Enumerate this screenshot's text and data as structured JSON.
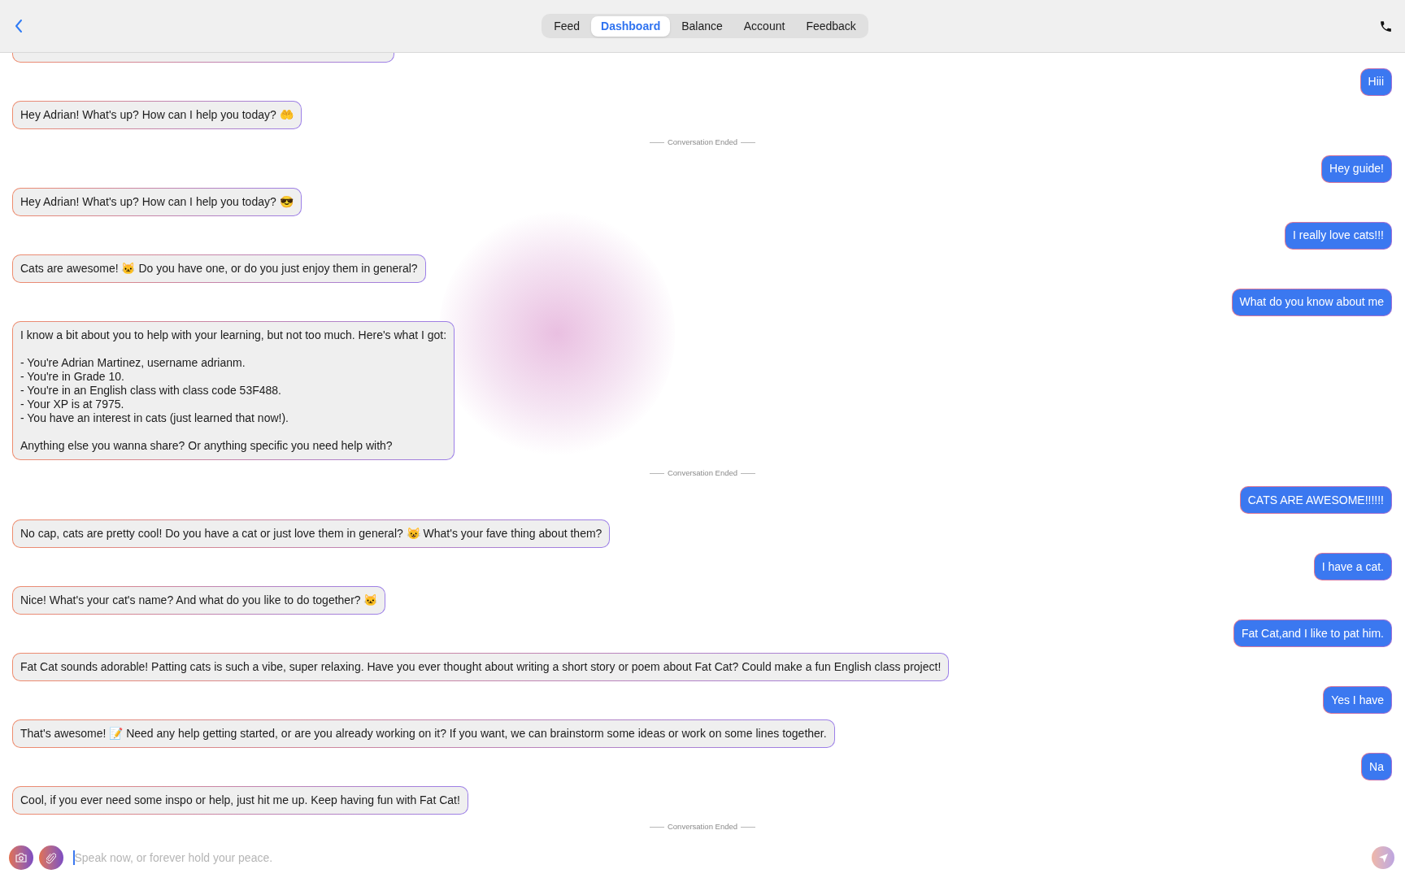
{
  "header": {
    "tabs": [
      {
        "label": "Feed",
        "selected": false
      },
      {
        "label": "Dashboard",
        "selected": true
      },
      {
        "label": "Balance",
        "selected": false
      },
      {
        "label": "Account",
        "selected": false
      },
      {
        "label": "Feedback",
        "selected": false
      }
    ]
  },
  "messages": [
    {
      "kind": "clipped"
    },
    {
      "kind": "outgoing",
      "text": "Hiii"
    },
    {
      "kind": "incoming",
      "text": "Hey Adrian! What's up? How can I help you today? 🤲"
    },
    {
      "kind": "divider",
      "text": "Conversation Ended"
    },
    {
      "kind": "outgoing",
      "text": "Hey guide!"
    },
    {
      "kind": "incoming",
      "text": "Hey Adrian! What's up? How can I help you today? 😎"
    },
    {
      "kind": "outgoing",
      "text": "I really love cats!!!"
    },
    {
      "kind": "incoming",
      "text": "Cats are awesome! 🐱 Do you have one, or do you just enjoy them in general?"
    },
    {
      "kind": "outgoing",
      "text": "What do you know about me"
    },
    {
      "kind": "incoming",
      "text": "I know a bit about you to help with your learning, but not too much. Here's what I got:\n\n- You're Adrian Martinez, username adrianm.\n- You're in Grade 10.\n- You're in an English class with class code 53F488.\n- Your XP is at 7975.\n- You have an interest in cats (just learned that now!).\n\nAnything else you wanna share? Or anything specific you need help with?"
    },
    {
      "kind": "divider",
      "text": "Conversation Ended"
    },
    {
      "kind": "outgoing",
      "text": "CATS ARE AWESOME!!!!!!"
    },
    {
      "kind": "incoming",
      "text": "No cap, cats are pretty cool! Do you have a cat or just love them in general? 😺 What's your fave thing about them?"
    },
    {
      "kind": "outgoing",
      "text": "I have a cat."
    },
    {
      "kind": "incoming",
      "text": "Nice! What's your cat's name? And what do you like to do together? 🐱"
    },
    {
      "kind": "outgoing",
      "text": "Fat Cat,and I like to pat him."
    },
    {
      "kind": "incoming",
      "text": "Fat Cat sounds adorable! Patting cats is such a vibe, super relaxing. Have you ever thought about writing a short story or poem about Fat Cat? Could make a fun English class project!"
    },
    {
      "kind": "outgoing",
      "text": "Yes I have"
    },
    {
      "kind": "incoming",
      "text": "That's awesome! 📝 Need any help getting started, or are you already working on it? If you want, we can brainstorm some ideas or work on some lines together."
    },
    {
      "kind": "outgoing",
      "text": "Na"
    },
    {
      "kind": "incoming",
      "text": "Cool, if you ever need some inspo or help, just hit me up. Keep having fun with Fat Cat!"
    },
    {
      "kind": "divider",
      "text": "Conversation Ended"
    }
  ],
  "composer": {
    "placeholder": "Speak now, or forever hold your peace.",
    "send_disabled": true
  }
}
